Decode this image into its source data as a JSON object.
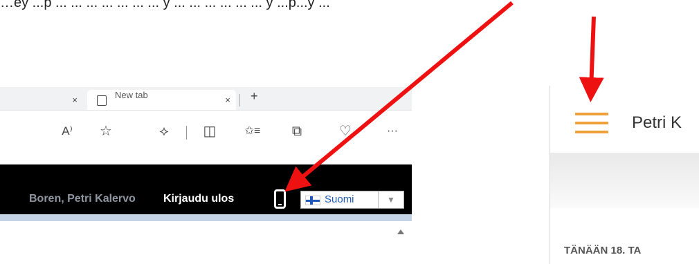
{
  "intro_text": "…ey ...p ... ... ... ... ... ... ... y ... ... ... ... ... ... y ...p...y ...",
  "browser": {
    "tabs": [
      {
        "label": "",
        "close": "×"
      },
      {
        "label": "New tab",
        "close": "×"
      }
    ],
    "new_tab_symbol": "+",
    "toolbar_icons": [
      {
        "name": "read-aloud-icon",
        "glyph": "A⁾"
      },
      {
        "name": "favorite-star-icon",
        "glyph": "☆"
      },
      {
        "name": "extensions-icon",
        "glyph": "⟡"
      },
      {
        "name": "split-screen-icon",
        "glyph": "◫"
      },
      {
        "name": "favorites-icon",
        "glyph": "✩≡"
      },
      {
        "name": "collections-icon",
        "glyph": "⧉"
      },
      {
        "name": "performance-icon",
        "glyph": "♡"
      },
      {
        "name": "more-icon",
        "glyph": "···"
      }
    ]
  },
  "site_header": {
    "user_name": "Boren, Petri Kalervo",
    "logout_label": "Kirjaudu ulos",
    "language_selected": "Suomi",
    "dropdown_arrow": "▼"
  },
  "mobile": {
    "title": "Petri K",
    "date_label": "TÄNÄÄN 18. TA"
  },
  "colors": {
    "arrow": "#ee1111",
    "hamburger": "#f0a03a",
    "header_bg": "#000000"
  }
}
